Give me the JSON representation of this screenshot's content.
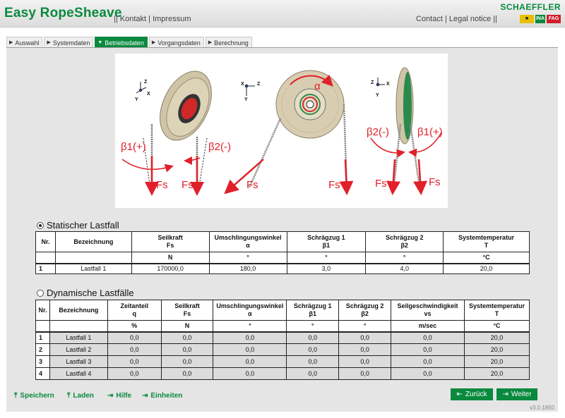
{
  "app": {
    "title": "Easy RopeSheave",
    "brand": "SCHAEFFLER",
    "version": "v3.0.1850",
    "logos": [
      "INA",
      "FAG"
    ]
  },
  "header_links": {
    "left": [
      "Kontakt",
      "Impressum"
    ],
    "right": [
      "Contact",
      "Legal notice"
    ]
  },
  "tabs": [
    {
      "label": "Auswahl",
      "active": false
    },
    {
      "label": "Systemdaten",
      "active": false
    },
    {
      "label": "Betriebsdaten",
      "active": true
    },
    {
      "label": "Vorgangsdaten",
      "active": false
    },
    {
      "label": "Berechnung",
      "active": false
    }
  ],
  "figure": {
    "labels": {
      "beta1_plus": "β1(+)",
      "beta2_minus": "β2(-)",
      "alpha": "α",
      "fs": "Fs"
    },
    "axes": {
      "x": "X",
      "y": "Y",
      "z": "Z"
    }
  },
  "static": {
    "title": "Statischer Lastfall",
    "selected": true,
    "headers": [
      [
        "Nr.",
        ""
      ],
      [
        "Bezeichnung",
        ""
      ],
      [
        "Seilkraft",
        "Fs"
      ],
      [
        "Umschlingungswinkel",
        "α"
      ],
      [
        "Schrägzug 1",
        "β1"
      ],
      [
        "Schrägzug 2",
        "β2"
      ],
      [
        "Systemtemperatur",
        "T"
      ]
    ],
    "units": [
      "",
      "",
      "N",
      "°",
      "°",
      "°",
      "°C"
    ],
    "rows": [
      {
        "nr": "1",
        "name": "Lastfall 1",
        "values": [
          "170000,0",
          "180,0",
          "3,0",
          "4,0",
          "20,0"
        ]
      }
    ]
  },
  "dynamic": {
    "title": "Dynamische Lastfälle",
    "selected": false,
    "headers": [
      [
        "Nr.",
        ""
      ],
      [
        "Bezeichnung",
        ""
      ],
      [
        "Zeitanteil",
        "q"
      ],
      [
        "Seilkraft",
        "Fs"
      ],
      [
        "Umschlingungswinkel",
        "α"
      ],
      [
        "Schrägzug 1",
        "β1"
      ],
      [
        "Schrägzug 2",
        "β2"
      ],
      [
        "Seilgeschwindigkeit",
        "vs"
      ],
      [
        "Systemtemperatur",
        "T"
      ]
    ],
    "units": [
      "",
      "",
      "%",
      "N",
      "°",
      "°",
      "°",
      "m/sec",
      "°C"
    ],
    "rows": [
      {
        "nr": "1",
        "name": "Lastfall 1",
        "values": [
          "0,0",
          "0,0",
          "0,0",
          "0,0",
          "0,0",
          "0,0",
          "20,0"
        ]
      },
      {
        "nr": "2",
        "name": "Lastfall 2",
        "values": [
          "0,0",
          "0,0",
          "0,0",
          "0,0",
          "0,0",
          "0,0",
          "20,0"
        ]
      },
      {
        "nr": "3",
        "name": "Lastfall 3",
        "values": [
          "0,0",
          "0,0",
          "0,0",
          "0,0",
          "0,0",
          "0,0",
          "20,0"
        ]
      },
      {
        "nr": "4",
        "name": "Lastfall 4",
        "values": [
          "0,0",
          "0,0",
          "0,0",
          "0,0",
          "0,0",
          "0,0",
          "20,0"
        ]
      }
    ]
  },
  "footer": {
    "links": [
      {
        "label": "Speichern",
        "icon": "save-icon"
      },
      {
        "label": "Laden",
        "icon": "load-icon"
      },
      {
        "label": "Hilfe",
        "icon": "help-icon"
      },
      {
        "label": "Einheiten",
        "icon": "units-icon"
      }
    ],
    "back_label": "Zurück",
    "next_label": "Weiter"
  },
  "colors": {
    "accent": "#0a8a3e",
    "force_red": "#e0202a",
    "panel": "#e5e5e5"
  }
}
